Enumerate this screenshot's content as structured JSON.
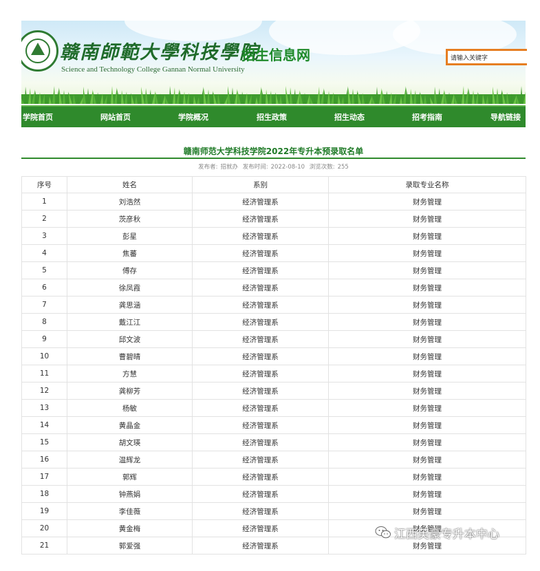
{
  "header": {
    "school_name_cn": "赣南師範大學科技學院",
    "school_name_en": "Science and Technology College Gannan Normal University",
    "site_name": "招生信息网",
    "search_value": "请输入关键字",
    "logo_icon": "school-seal-icon",
    "colors": {
      "accent": "#2f8a2c",
      "title": "#1e7a26",
      "search_border": "#e67e22"
    }
  },
  "nav": {
    "items": [
      {
        "label": "学院首页"
      },
      {
        "label": "网站首页"
      },
      {
        "label": "学院概况"
      },
      {
        "label": "招生政策"
      },
      {
        "label": "招生动态"
      },
      {
        "label": "招考指南"
      },
      {
        "label": "导航链接"
      }
    ]
  },
  "article": {
    "title": "赣南师范大学科技学院2022年专升本预录取名单",
    "meta": {
      "publisher_label": "发布者:",
      "publisher": "招就办",
      "date_label": "发布时间:",
      "date": "2022-08-10",
      "views_label": "浏览次数:",
      "views": "255"
    }
  },
  "table": {
    "headers": [
      "序号",
      "姓名",
      "系别",
      "录取专业名称"
    ],
    "rows": [
      [
        "1",
        "刘浩然",
        "经济管理系",
        "财务管理"
      ],
      [
        "2",
        "茨彦秋",
        "经济管理系",
        "财务管理"
      ],
      [
        "3",
        "彭星",
        "经济管理系",
        "财务管理"
      ],
      [
        "4",
        "焦蕃",
        "经济管理系",
        "财务管理"
      ],
      [
        "5",
        "傅存",
        "经济管理系",
        "财务管理"
      ],
      [
        "6",
        "徐凤霞",
        "经济管理系",
        "财务管理"
      ],
      [
        "7",
        "龚思涵",
        "经济管理系",
        "财务管理"
      ],
      [
        "8",
        "戴江江",
        "经济管理系",
        "财务管理"
      ],
      [
        "9",
        "邱文波",
        "经济管理系",
        "财务管理"
      ],
      [
        "10",
        "曹碧晴",
        "经济管理系",
        "财务管理"
      ],
      [
        "11",
        "方慧",
        "经济管理系",
        "财务管理"
      ],
      [
        "12",
        "龚柳芳",
        "经济管理系",
        "财务管理"
      ],
      [
        "13",
        "杨敏",
        "经济管理系",
        "财务管理"
      ],
      [
        "14",
        "黄晶金",
        "经济管理系",
        "财务管理"
      ],
      [
        "15",
        "胡文瑛",
        "经济管理系",
        "财务管理"
      ],
      [
        "16",
        "温辉龙",
        "经济管理系",
        "财务管理"
      ],
      [
        "17",
        "郭辉",
        "经济管理系",
        "财务管理"
      ],
      [
        "18",
        "钟燕娟",
        "经济管理系",
        "财务管理"
      ],
      [
        "19",
        "李佳薇",
        "经济管理系",
        "财务管理"
      ],
      [
        "20",
        "黄金梅",
        "经济管理系",
        "财务管理"
      ],
      [
        "21",
        "郭爱强",
        "经济管理系",
        "财务管理"
      ]
    ]
  },
  "watermark": {
    "text": "江西英豪专升本中心",
    "icon": "wechat-icon"
  }
}
